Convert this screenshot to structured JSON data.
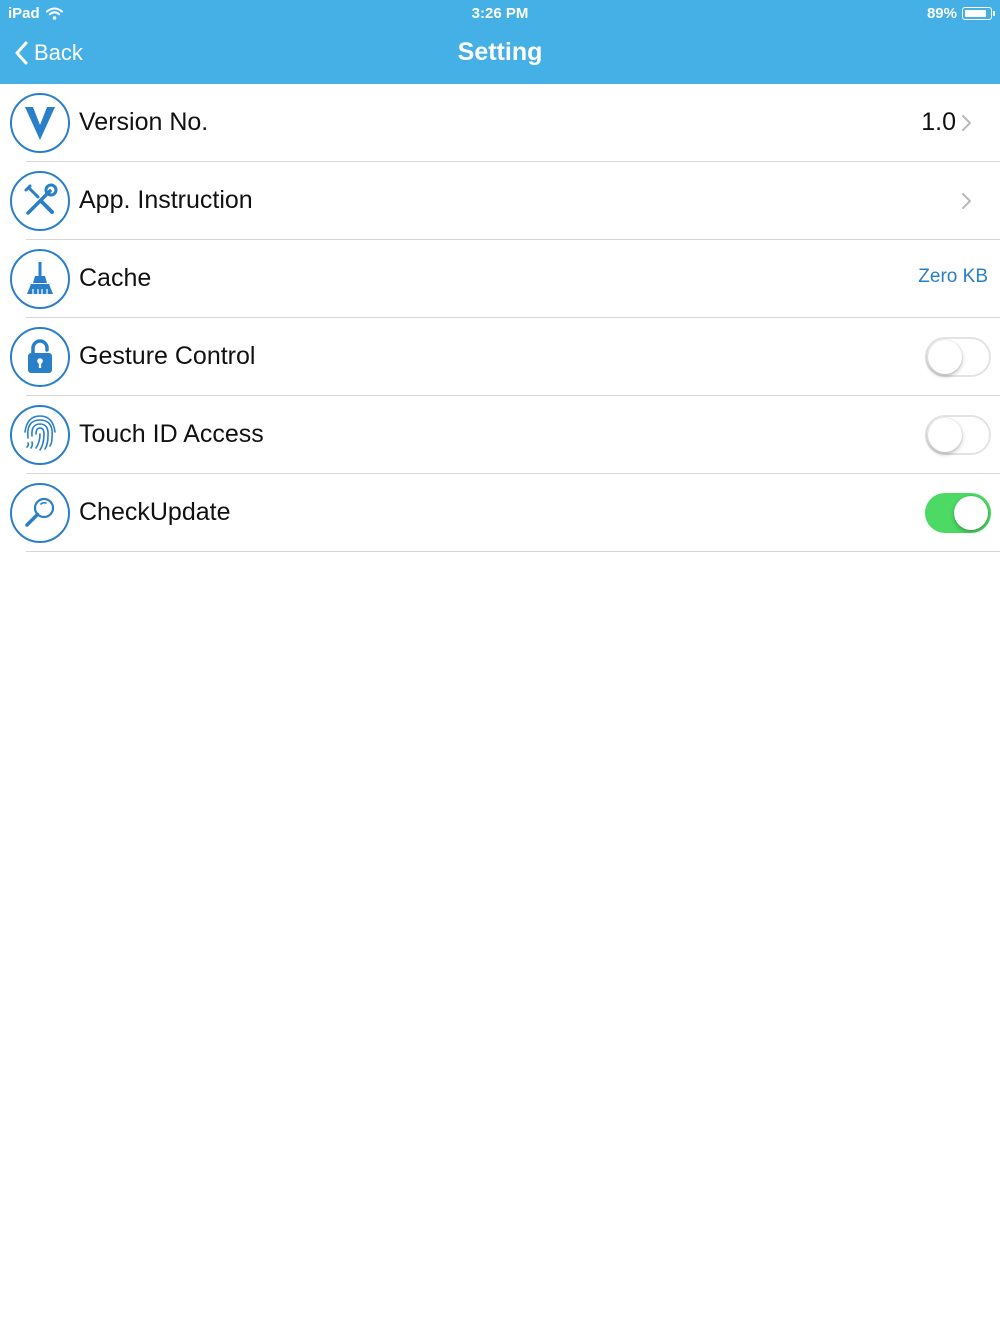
{
  "status_bar": {
    "carrier": "iPad",
    "wifi_icon": "wifi-icon",
    "time": "3:26 PM",
    "battery_percent": "89%",
    "battery_level": 0.89
  },
  "nav": {
    "back_label": "Back",
    "title": "Setting",
    "bar_color": "#45b0e6"
  },
  "settings": {
    "accent_color": "#2a7fc9",
    "items": [
      {
        "label": "Version No.",
        "icon": "version-v-icon",
        "value": "1.0",
        "accessory": "chevron"
      },
      {
        "label": "App. Instruction",
        "icon": "tools-icon",
        "accessory": "chevron"
      },
      {
        "label": "Cache",
        "icon": "broom-icon",
        "value": "Zero KB"
      },
      {
        "label": "Gesture Control",
        "icon": "lock-icon",
        "toggle_on": false
      },
      {
        "label": "Touch ID Access",
        "icon": "fingerprint-icon",
        "toggle_on": false
      },
      {
        "label": "CheckUpdate",
        "icon": "magnifier-icon",
        "toggle_on": true
      }
    ]
  }
}
